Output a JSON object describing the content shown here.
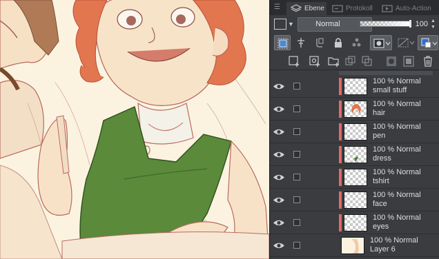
{
  "panel": {
    "tabs": [
      {
        "label": "Ebene",
        "icon": "layers-icon",
        "active": true
      },
      {
        "label": "Protokoll",
        "icon": "history-icon",
        "active": false
      },
      {
        "label": "Auto-Action",
        "icon": "auto-action-icon",
        "active": false
      }
    ],
    "blend_mode": "Normal",
    "opacity": {
      "value": "100",
      "fraction": 1.0
    },
    "tools": [
      "select-layer-icon",
      "layer-gesture-icon",
      "clipping-icon",
      "lock-icon",
      "reference-layer-icon",
      "mask-enable-icon",
      "mask-disable-icon",
      "layer-color-icon"
    ],
    "actions": [
      "new-raster-layer-icon",
      "new-vector-layer-icon",
      "new-folder-icon",
      "copy-layer-icon",
      "merge-down-icon",
      "add-mask-icon",
      "apply-mask-icon",
      "delete-layer-icon"
    ]
  },
  "layers": [
    {
      "mode": "100 % Normal",
      "name": "small stuff",
      "visible": true,
      "accent": "#e06a6a",
      "thumb": "blank"
    },
    {
      "mode": "100 % Normal",
      "name": "hair",
      "visible": true,
      "accent": "#e06a6a",
      "thumb": "hair"
    },
    {
      "mode": "100 % Normal",
      "name": "pen",
      "visible": true,
      "accent": "#e06a6a",
      "thumb": "blank"
    },
    {
      "mode": "100 % Normal",
      "name": "dress",
      "visible": true,
      "accent": "#e06a6a",
      "thumb": "dress"
    },
    {
      "mode": "100 % Normal",
      "name": "tshirt",
      "visible": true,
      "accent": "#e06a6a",
      "thumb": "blank"
    },
    {
      "mode": "100 % Normal",
      "name": "face",
      "visible": true,
      "accent": "#e06a6a",
      "thumb": "blank"
    },
    {
      "mode": "100 % Normal",
      "name": "eyes",
      "visible": true,
      "accent": "#e06a6a",
      "thumb": "blank"
    },
    {
      "mode": "100 % Normal",
      "name": "Layer 6",
      "visible": true,
      "accent": "",
      "thumb": "skin"
    }
  ],
  "colors": {
    "canvas_bg": "#fbf3df",
    "hair": "#e2764f",
    "dress": "#5a8a3a",
    "sketch_line": "#b86a62",
    "panel_bg": "#3a3c40",
    "layer_accent": "#e06a6a"
  }
}
